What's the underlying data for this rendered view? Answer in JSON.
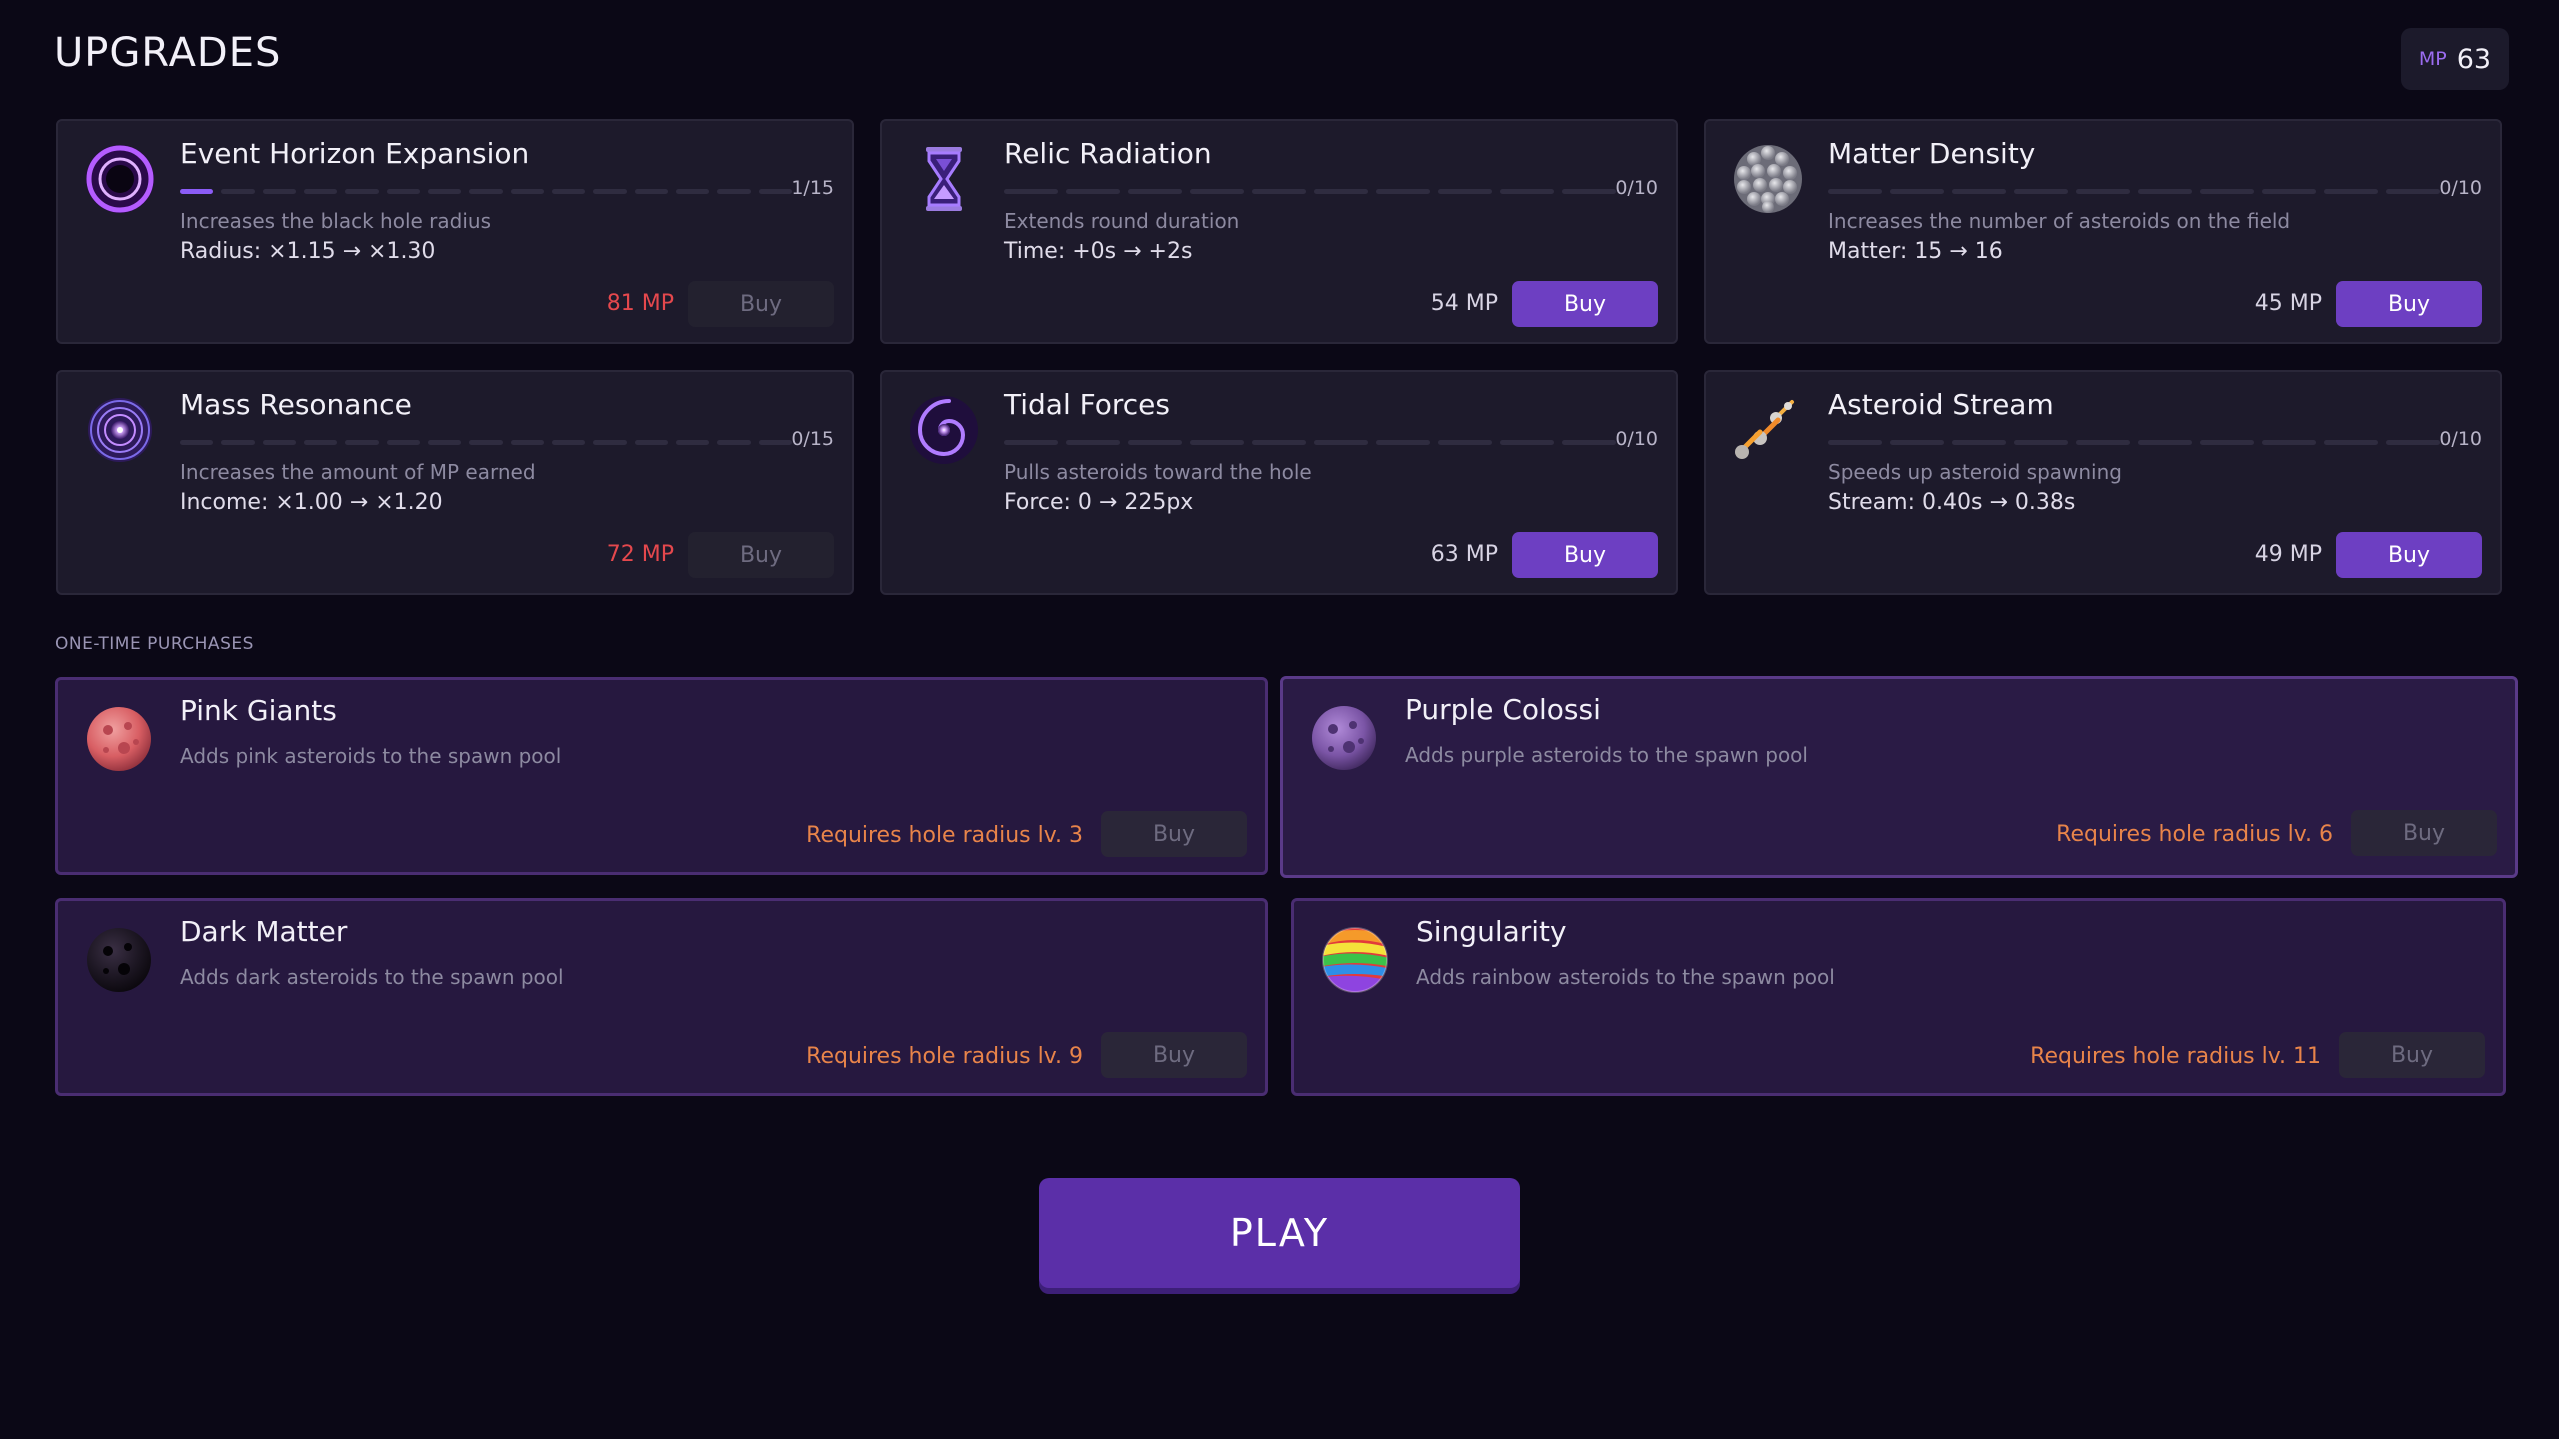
{
  "header": {
    "title": "UPGRADES",
    "mp_label": "MP",
    "mp_value": "63"
  },
  "upgrades": [
    {
      "title": "Event Horizon Expansion",
      "icon": "black-hole-ring-icon",
      "level": 1,
      "max": 15,
      "count": "1/15",
      "desc": "Increases the black hole radius",
      "stat": "Radius: ×1.15 → ×1.30",
      "price": "81 MP",
      "affordable": false,
      "buy": "Buy"
    },
    {
      "title": "Relic Radiation",
      "icon": "hourglass-icon",
      "level": 0,
      "max": 10,
      "count": "0/10",
      "desc": "Extends round duration",
      "stat": "Time: +0s → +2s",
      "price": "54 MP",
      "affordable": true,
      "buy": "Buy"
    },
    {
      "title": "Matter Density",
      "icon": "asteroid-cluster-icon",
      "level": 0,
      "max": 10,
      "count": "0/10",
      "desc": "Increases the number of asteroids on the field",
      "stat": "Matter: 15 → 16",
      "price": "45 MP",
      "affordable": true,
      "buy": "Buy"
    },
    {
      "title": "Mass Resonance",
      "icon": "resonance-orb-icon",
      "level": 0,
      "max": 15,
      "count": "0/15",
      "desc": "Increases the amount of MP earned",
      "stat": "Income: ×1.00 → ×1.20",
      "price": "72 MP",
      "affordable": false,
      "buy": "Buy"
    },
    {
      "title": "Tidal Forces",
      "icon": "spiral-galaxy-icon",
      "level": 0,
      "max": 10,
      "count": "0/10",
      "desc": "Pulls asteroids toward the hole",
      "stat": "Force: 0 → 225px",
      "price": "63 MP",
      "affordable": true,
      "buy": "Buy"
    },
    {
      "title": "Asteroid Stream",
      "icon": "meteor-stream-icon",
      "level": 0,
      "max": 10,
      "count": "0/10",
      "desc": "Speeds up asteroid spawning",
      "stat": "Stream: 0.40s → 0.38s",
      "price": "49 MP",
      "affordable": true,
      "buy": "Buy"
    }
  ],
  "one_time": {
    "label": "ONE-TIME PURCHASES",
    "items": [
      {
        "title": "Pink Giants",
        "icon": "pink-asteroid-icon",
        "desc": "Adds pink asteroids to the spawn pool",
        "requirement": "Requires hole radius lv. 3",
        "buy": "Buy"
      },
      {
        "title": "Purple Colossi",
        "icon": "purple-asteroid-icon",
        "desc": "Adds purple asteroids to the spawn pool",
        "requirement": "Requires hole radius lv. 6",
        "buy": "Buy"
      },
      {
        "title": "Dark Matter",
        "icon": "dark-asteroid-icon",
        "desc": "Adds dark asteroids to the spawn pool",
        "requirement": "Requires hole radius lv. 9",
        "buy": "Buy"
      },
      {
        "title": "Singularity",
        "icon": "rainbow-asteroid-icon",
        "desc": "Adds rainbow asteroids to the spawn pool",
        "requirement": "Requires hole radius lv. 11",
        "buy": "Buy"
      }
    ]
  },
  "play_label": "PLAY",
  "colors": {
    "accent": "#6d3fc2",
    "price_red": "#e5484d",
    "requirement_orange": "#e8844a"
  }
}
